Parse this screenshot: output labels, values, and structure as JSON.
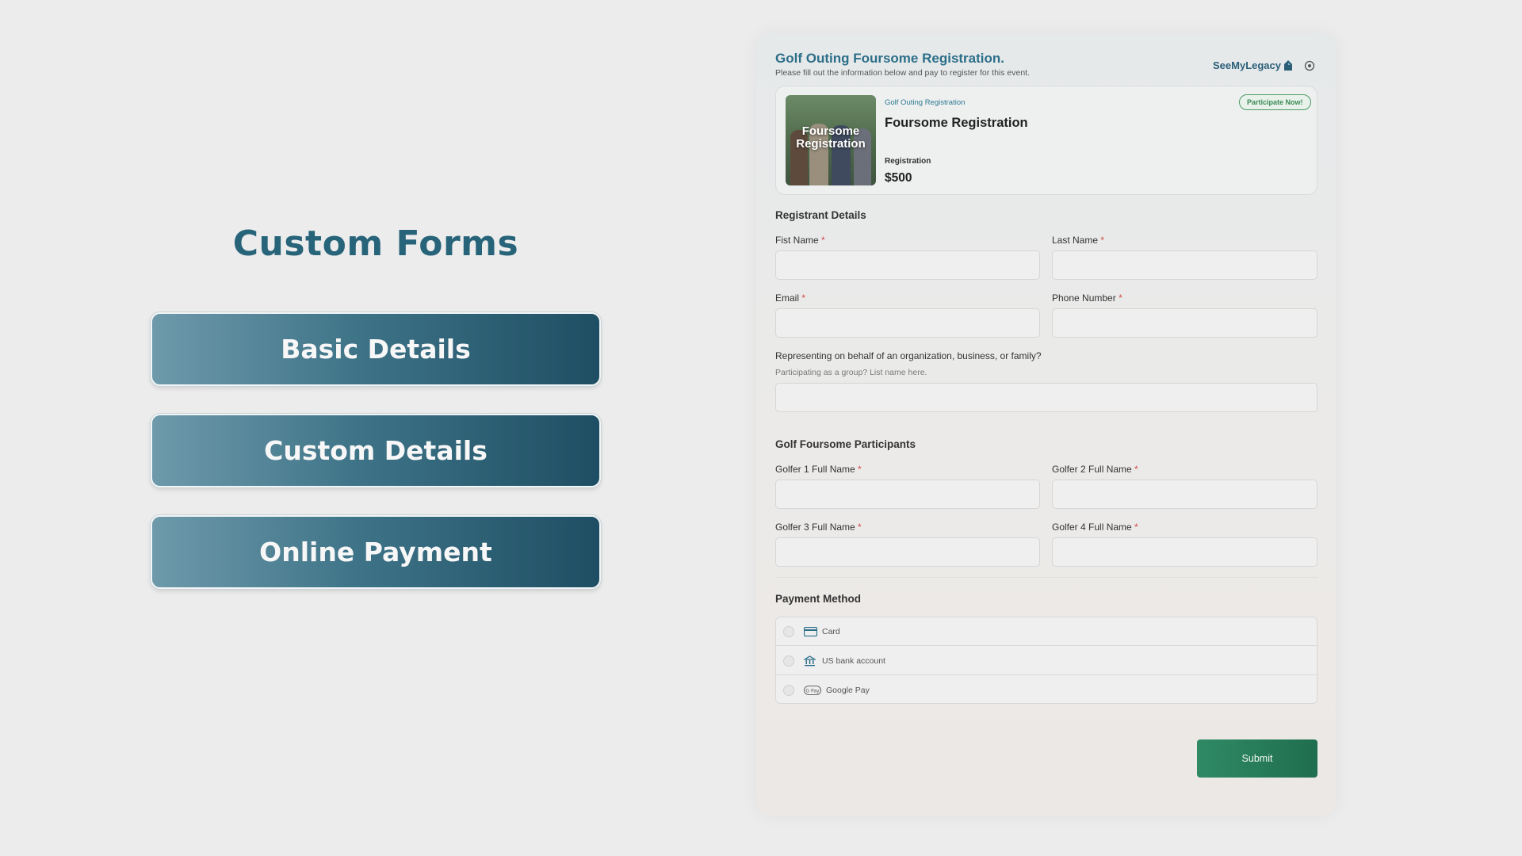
{
  "left": {
    "title": "Custom Forms",
    "buttons": [
      "Basic Details",
      "Custom Details",
      "Online Payment"
    ]
  },
  "form": {
    "title": "Golf Outing Foursome Registration.",
    "subtitle": "Please fill out the information below and pay to register for this event.",
    "brand": "SeeMyLegacy",
    "event": {
      "category": "Golf Outing Registration",
      "name": "Foursome Registration",
      "thumb_text": "Foursome Registration",
      "badge": "Participate Now!",
      "price_label": "Registration",
      "price": "$500"
    },
    "registrant": {
      "heading": "Registrant Details",
      "first_name": "Fist Name",
      "last_name": "Last Name",
      "email": "Email",
      "phone": "Phone Number",
      "org_question": "Representing on behalf of an organization, business, or family?",
      "org_hint": "Participating as a group? List name here."
    },
    "participants": {
      "heading": "Golf Foursome Participants",
      "golfer1": "Golfer 1 Full Name",
      "golfer2": "Golfer 2 Full Name",
      "golfer3": "Golfer 3 Full Name",
      "golfer4": "Golfer 4 Full Name"
    },
    "payment": {
      "heading": "Payment Method",
      "options": [
        "Card",
        "US bank account",
        "Google Pay"
      ],
      "gpay_icon_text": "G Pay"
    },
    "submit_label": "Submit",
    "required_marker": "*"
  },
  "colors": {
    "accent": "#27647a",
    "button_gradient_start": "#6e9aab",
    "button_gradient_end": "#1e4e63",
    "submit_green": "#2f8a64",
    "required_red": "#d04a4a"
  }
}
